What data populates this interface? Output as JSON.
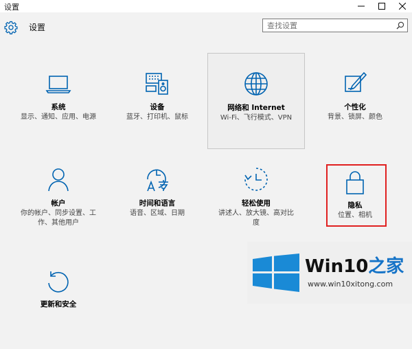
{
  "window": {
    "title": "设置"
  },
  "header": {
    "title": "设置"
  },
  "search": {
    "placeholder": "查找设置"
  },
  "tiles": [
    {
      "label": "系统",
      "desc": "显示、通知、应用、电源",
      "icon": "laptop-icon"
    },
    {
      "label": "设备",
      "desc": "蓝牙、打印机、鼠标",
      "icon": "devices-icon"
    },
    {
      "label": "网络和 Internet",
      "desc": "Wi-Fi、飞行模式、VPN",
      "icon": "globe-icon"
    },
    {
      "label": "个性化",
      "desc": "背景、锁屏、颜色",
      "icon": "personalization-icon"
    },
    {
      "label": "帐户",
      "desc": "你的帐户、同步设置、工作、其他用户",
      "icon": "person-icon"
    },
    {
      "label": "时间和语言",
      "desc": "语音、区域、日期",
      "icon": "time-language-icon"
    },
    {
      "label": "轻松使用",
      "desc": "讲述人、放大镜、高对比度",
      "icon": "ease-of-access-icon"
    },
    {
      "label": "隐私",
      "desc": "位置、相机",
      "icon": "lock-icon"
    },
    {
      "label": "更新和安全",
      "desc": "",
      "icon": "update-icon"
    }
  ],
  "watermark": {
    "brand_prefix": "Win10",
    "brand_suffix": "之家",
    "url": "www.win10xitong.com"
  },
  "colors": {
    "accent": "#0063b1",
    "highlight_border": "#e02020",
    "background": "#f2f2f2"
  }
}
